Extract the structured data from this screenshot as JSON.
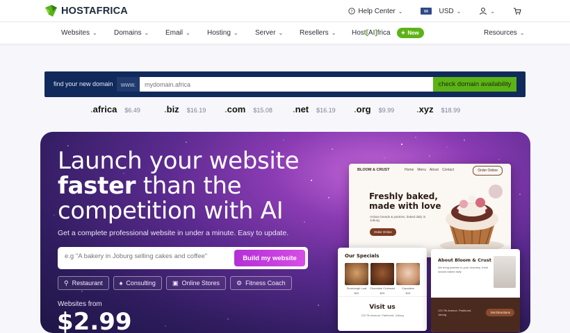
{
  "brand": {
    "name": "HOSTAFRICA",
    "brand_color": "#5cb316"
  },
  "topbar": {
    "help_label": "Help Center",
    "currency_label": "USD",
    "account_icon": "user-icon",
    "cart_icon": "cart-icon"
  },
  "nav": {
    "items": [
      {
        "label": "Websites"
      },
      {
        "label": "Domains"
      },
      {
        "label": "Email"
      },
      {
        "label": "Hosting"
      },
      {
        "label": "Server"
      },
      {
        "label": "Resellers"
      }
    ],
    "ai_brand": {
      "prefix": "Host",
      "bracket_open": "[",
      "ai": "AI",
      "bracket_close": "]",
      "suffix": "frica"
    },
    "new_badge": "New",
    "resources_label": "Resources"
  },
  "domain_search": {
    "label": "find your new domain",
    "prefix": "www.",
    "placeholder": "mydomain.africa",
    "button_label": "check domain availability",
    "band_color": "#112a5c"
  },
  "tlds": [
    {
      "name": "africa",
      "price": "$6.49"
    },
    {
      "name": "biz",
      "price": "$16.19"
    },
    {
      "name": "com",
      "price": "$15.08"
    },
    {
      "name": "net",
      "price": "$16.19"
    },
    {
      "name": "org",
      "price": "$9.99"
    },
    {
      "name": "xyz",
      "price": "$18.99"
    }
  ],
  "hero": {
    "headline_line1": "Launch your website",
    "headline_emphasis": "faster",
    "headline_line2_rest": " than the",
    "headline_line3": "competition with AI",
    "subtitle": "Get a complete professional website in under a minute. Easy to update.",
    "prompt_placeholder": "e.g \"A bakery in Joburg selling cakes and coffee\"",
    "build_button": "Build my website",
    "chips": [
      {
        "label": "Restaurant",
        "icon": "utensils-icon"
      },
      {
        "label": "Consulting",
        "icon": "people-icon"
      },
      {
        "label": "Online Stores",
        "icon": "store-icon"
      },
      {
        "label": "Fitness Coach",
        "icon": "dumbbell-icon"
      }
    ],
    "from_label": "Websites from",
    "price": "$2.99"
  },
  "mockup": {
    "brand": "BLOOM & CRUST",
    "links": [
      "Home",
      "Menu",
      "About",
      "Contact"
    ],
    "order_button": "Order Online",
    "headline_line1": "Freshly baked,",
    "headline_line2": "made with love",
    "blurb": "Artisan breads & pastries, baked daily in Joburg",
    "cta": "Order Online",
    "specials_title": "Our Specials",
    "specials": [
      {
        "name": "Sourdough Loaf",
        "price": "$20"
      },
      {
        "name": "Chocolate Croissant",
        "price": "$25"
      },
      {
        "name": "Cupcakes",
        "price": "$15"
      }
    ],
    "visit_title": "Visit us",
    "visit_address": "123 7th Avenue, Parkhurst, Joburg",
    "about_title": "About Bloom & Crust",
    "about_text": "We bring pastries to your doorstep, fresh snacks baked daily",
    "about_address": "123 7th Avenue, Parkhurst, Joburg",
    "directions_button": "Get Directions"
  }
}
